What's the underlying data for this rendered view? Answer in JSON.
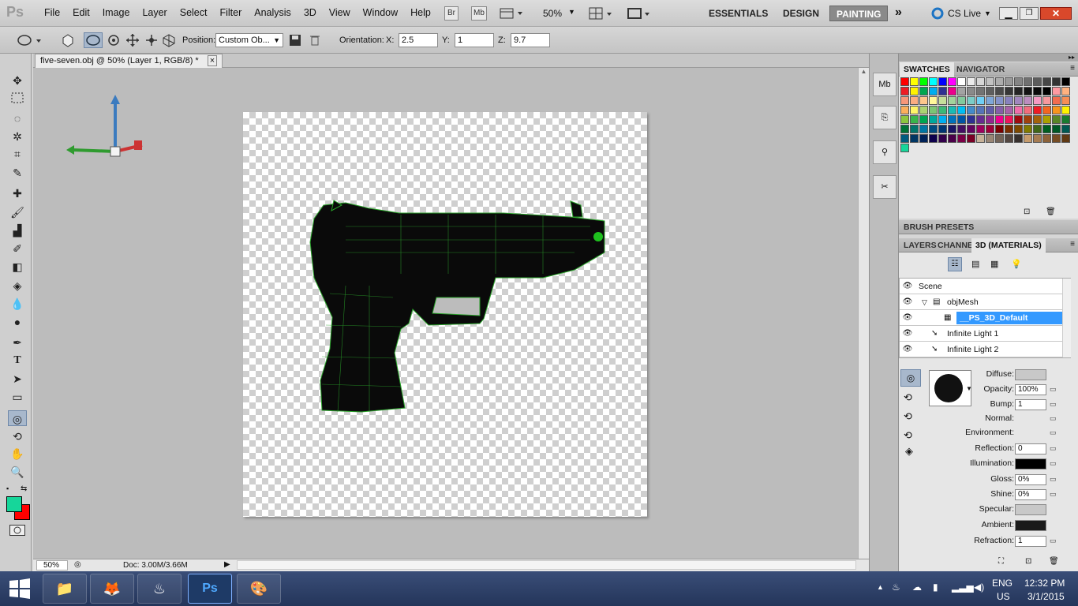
{
  "app": {
    "logo": "Ps"
  },
  "menu": [
    "File",
    "Edit",
    "Image",
    "Layer",
    "Select",
    "Filter",
    "Analysis",
    "3D",
    "View",
    "Window",
    "Help"
  ],
  "topbar": {
    "bridge": "Br",
    "minibridge": "Mb",
    "zoom": "50%",
    "workspaces": [
      "ESSENTIALS",
      "DESIGN",
      "PAINTING"
    ],
    "more": "»",
    "cs_live": "CS Live"
  },
  "options": {
    "position_label": "Position:",
    "position_value": "Custom Ob...",
    "orientation_label": "Orientation:",
    "x_label": "X:",
    "x_value": "2.5",
    "y_label": "Y:",
    "y_value": "1",
    "z_label": "Z:",
    "z_value": "9.7"
  },
  "document": {
    "tab_title": "five-seven.obj @ 50% (Layer 1, RGB/8) *",
    "close": "×"
  },
  "status": {
    "zoom": "50%",
    "doc": "Doc: 3.00M/3.66M"
  },
  "colors": {
    "foreground": "#16d69a",
    "background": "#ff0000",
    "accent": "#3399ff"
  },
  "panels": {
    "swatches_tab": "SWATCHES",
    "navigator_tab": "NAVIGATOR",
    "brush_presets": "BRUSH PRESETS",
    "layers_tab": "LAYERS",
    "channels_tab": "CHANNE",
    "materials_tab": "3D (MATERIALS)",
    "tree": [
      {
        "label": "Scene"
      },
      {
        "label": "objMesh"
      },
      {
        "label": "__PS_3D_Default"
      },
      {
        "label": "Infinite Light 1"
      },
      {
        "label": "Infinite Light 2"
      }
    ],
    "material_props": [
      {
        "label": "Diffuse:",
        "value": ""
      },
      {
        "label": "Opacity:",
        "value": "100%"
      },
      {
        "label": "Bump:",
        "value": "1"
      },
      {
        "label": "Normal:",
        "value": ""
      },
      {
        "label": "Environment:",
        "value": ""
      },
      {
        "label": "Reflection:",
        "value": "0"
      },
      {
        "label": "Illumination:",
        "value": ""
      },
      {
        "label": "Gloss:",
        "value": "0%"
      },
      {
        "label": "Shine:",
        "value": "0%"
      },
      {
        "label": "Specular:",
        "value": ""
      },
      {
        "label": "Ambient:",
        "value": ""
      },
      {
        "label": "Refraction:",
        "value": "1"
      }
    ]
  },
  "swatch_colors": [
    "#ff0000",
    "#ffff00",
    "#00ff00",
    "#00ffff",
    "#0000ff",
    "#ff00ff",
    "#ffffff",
    "#ebebeb",
    "#d6d6d6",
    "#c2c2c2",
    "#adadad",
    "#999999",
    "#858585",
    "#707070",
    "#5c5c5c",
    "#474747",
    "#333333",
    "#000000",
    "#ee1c24",
    "#fff200",
    "#00a650",
    "#00aeef",
    "#2e3192",
    "#ec008c",
    "#a3a3a3",
    "#8a8a8a",
    "#737373",
    "#5e5e5e",
    "#4a4a4a",
    "#363636",
    "#242424",
    "#141414",
    "#0a0a0a",
    "#000000",
    "#ff9aa2",
    "#ffb27f",
    "#f7977a",
    "#fbad82",
    "#fdc68c",
    "#fff79a",
    "#c4df9b",
    "#a2d39c",
    "#82ca9d",
    "#7bcdc8",
    "#6ecff6",
    "#7ea7d8",
    "#8493ca",
    "#8882be",
    "#a187be",
    "#bc8dbf",
    "#f49ac2",
    "#f6989d",
    "#f26c4f",
    "#f68e55",
    "#fbaf5c",
    "#fff467",
    "#acd372",
    "#7cc576",
    "#3bb878",
    "#1abbb4",
    "#00bff3",
    "#438ccb",
    "#5574b9",
    "#605ca8",
    "#855fa8",
    "#a763a9",
    "#f06eaa",
    "#f26d7d",
    "#ed1c24",
    "#f26522",
    "#f7941d",
    "#fff200",
    "#8dc63f",
    "#39b54a",
    "#00a651",
    "#00a99d",
    "#00aeef",
    "#0072bc",
    "#0054a5",
    "#2e3192",
    "#662d91",
    "#92278f",
    "#ec008c",
    "#ed145b",
    "#9e0b0f",
    "#a0410d",
    "#a3620a",
    "#aba000",
    "#598527",
    "#197b30",
    "#007236",
    "#00746b",
    "#0076a3",
    "#004a80",
    "#003471",
    "#1b1464",
    "#440e62",
    "#630460",
    "#9e005d",
    "#9e0039",
    "#790000",
    "#7b2e00",
    "#7d4900",
    "#827b00",
    "#406618",
    "#005e20",
    "#005826",
    "#005952",
    "#005b7f",
    "#003663",
    "#002157",
    "#0d004c",
    "#32004b",
    "#4b0049",
    "#7b0046",
    "#7a0026",
    "#c7b299",
    "#998675",
    "#736357",
    "#534741",
    "#37302d",
    "#c69c6d",
    "#a67c52",
    "#8c6239",
    "#754c24",
    "#603913",
    "#16d69a"
  ],
  "taskbar": {
    "lang": "ENG",
    "region": "US",
    "time": "12:32 PM",
    "date": "3/1/2015",
    "apps": [
      "📁",
      "🦊",
      "♨",
      "Ps",
      "🎨"
    ]
  }
}
